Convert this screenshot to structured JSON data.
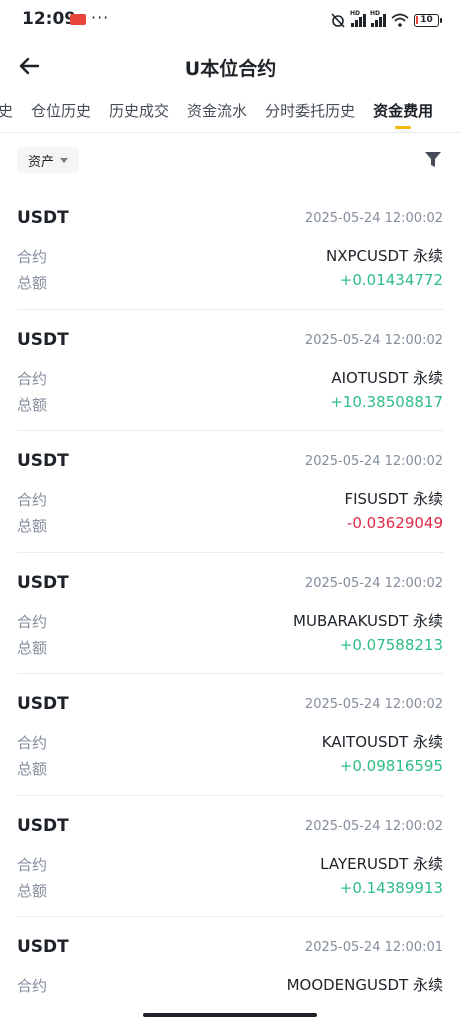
{
  "status_bar": {
    "time": "12:09",
    "battery": "10"
  },
  "header": {
    "title": "U本位合约"
  },
  "tabs": [
    {
      "label": "史"
    },
    {
      "label": "仓位历史"
    },
    {
      "label": "历史成交"
    },
    {
      "label": "资金流水"
    },
    {
      "label": "分时委托历史"
    },
    {
      "label": "资金费用",
      "active": true
    }
  ],
  "filter": {
    "asset_label": "资产"
  },
  "labels": {
    "contract": "合约",
    "amount": "总额"
  },
  "colors": {
    "positive": "#2ebd85",
    "negative": "#e0294a",
    "accent": "#f0b90b"
  },
  "records": [
    {
      "asset": "USDT",
      "time": "2025-05-24 12:00:02",
      "contract": "NXPCUSDT 永续",
      "amount": "+0.01434772",
      "sign": "pos"
    },
    {
      "asset": "USDT",
      "time": "2025-05-24 12:00:02",
      "contract": "AIOTUSDT 永续",
      "amount": "+10.38508817",
      "sign": "pos"
    },
    {
      "asset": "USDT",
      "time": "2025-05-24 12:00:02",
      "contract": "FISUSDT 永续",
      "amount": "-0.03629049",
      "sign": "neg"
    },
    {
      "asset": "USDT",
      "time": "2025-05-24 12:00:02",
      "contract": "MUBARAKUSDT 永续",
      "amount": "+0.07588213",
      "sign": "pos"
    },
    {
      "asset": "USDT",
      "time": "2025-05-24 12:00:02",
      "contract": "KAITOUSDT 永续",
      "amount": "+0.09816595",
      "sign": "pos"
    },
    {
      "asset": "USDT",
      "time": "2025-05-24 12:00:02",
      "contract": "LAYERUSDT 永续",
      "amount": "+0.14389913",
      "sign": "pos"
    },
    {
      "asset": "USDT",
      "time": "2025-05-24 12:00:01",
      "contract": "MOODENGUSDT 永续",
      "amount": "",
      "sign": "pos"
    }
  ]
}
